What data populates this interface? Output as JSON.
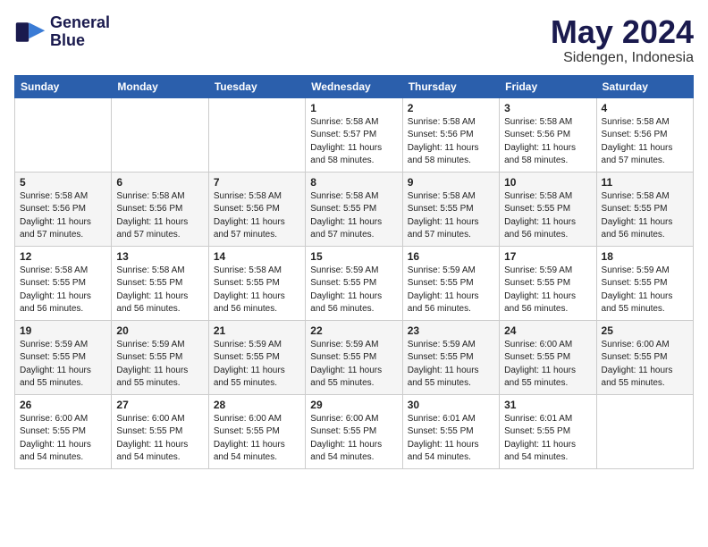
{
  "header": {
    "logo_line1": "General",
    "logo_line2": "Blue",
    "main_title": "May 2024",
    "sub_title": "Sidengen, Indonesia"
  },
  "weekdays": [
    "Sunday",
    "Monday",
    "Tuesday",
    "Wednesday",
    "Thursday",
    "Friday",
    "Saturday"
  ],
  "weeks": [
    [
      {
        "day": "",
        "info": ""
      },
      {
        "day": "",
        "info": ""
      },
      {
        "day": "",
        "info": ""
      },
      {
        "day": "1",
        "info": "Sunrise: 5:58 AM\nSunset: 5:57 PM\nDaylight: 11 hours\nand 58 minutes."
      },
      {
        "day": "2",
        "info": "Sunrise: 5:58 AM\nSunset: 5:56 PM\nDaylight: 11 hours\nand 58 minutes."
      },
      {
        "day": "3",
        "info": "Sunrise: 5:58 AM\nSunset: 5:56 PM\nDaylight: 11 hours\nand 58 minutes."
      },
      {
        "day": "4",
        "info": "Sunrise: 5:58 AM\nSunset: 5:56 PM\nDaylight: 11 hours\nand 57 minutes."
      }
    ],
    [
      {
        "day": "5",
        "info": "Sunrise: 5:58 AM\nSunset: 5:56 PM\nDaylight: 11 hours\nand 57 minutes."
      },
      {
        "day": "6",
        "info": "Sunrise: 5:58 AM\nSunset: 5:56 PM\nDaylight: 11 hours\nand 57 minutes."
      },
      {
        "day": "7",
        "info": "Sunrise: 5:58 AM\nSunset: 5:56 PM\nDaylight: 11 hours\nand 57 minutes."
      },
      {
        "day": "8",
        "info": "Sunrise: 5:58 AM\nSunset: 5:55 PM\nDaylight: 11 hours\nand 57 minutes."
      },
      {
        "day": "9",
        "info": "Sunrise: 5:58 AM\nSunset: 5:55 PM\nDaylight: 11 hours\nand 57 minutes."
      },
      {
        "day": "10",
        "info": "Sunrise: 5:58 AM\nSunset: 5:55 PM\nDaylight: 11 hours\nand 56 minutes."
      },
      {
        "day": "11",
        "info": "Sunrise: 5:58 AM\nSunset: 5:55 PM\nDaylight: 11 hours\nand 56 minutes."
      }
    ],
    [
      {
        "day": "12",
        "info": "Sunrise: 5:58 AM\nSunset: 5:55 PM\nDaylight: 11 hours\nand 56 minutes."
      },
      {
        "day": "13",
        "info": "Sunrise: 5:58 AM\nSunset: 5:55 PM\nDaylight: 11 hours\nand 56 minutes."
      },
      {
        "day": "14",
        "info": "Sunrise: 5:58 AM\nSunset: 5:55 PM\nDaylight: 11 hours\nand 56 minutes."
      },
      {
        "day": "15",
        "info": "Sunrise: 5:59 AM\nSunset: 5:55 PM\nDaylight: 11 hours\nand 56 minutes."
      },
      {
        "day": "16",
        "info": "Sunrise: 5:59 AM\nSunset: 5:55 PM\nDaylight: 11 hours\nand 56 minutes."
      },
      {
        "day": "17",
        "info": "Sunrise: 5:59 AM\nSunset: 5:55 PM\nDaylight: 11 hours\nand 56 minutes."
      },
      {
        "day": "18",
        "info": "Sunrise: 5:59 AM\nSunset: 5:55 PM\nDaylight: 11 hours\nand 55 minutes."
      }
    ],
    [
      {
        "day": "19",
        "info": "Sunrise: 5:59 AM\nSunset: 5:55 PM\nDaylight: 11 hours\nand 55 minutes."
      },
      {
        "day": "20",
        "info": "Sunrise: 5:59 AM\nSunset: 5:55 PM\nDaylight: 11 hours\nand 55 minutes."
      },
      {
        "day": "21",
        "info": "Sunrise: 5:59 AM\nSunset: 5:55 PM\nDaylight: 11 hours\nand 55 minutes."
      },
      {
        "day": "22",
        "info": "Sunrise: 5:59 AM\nSunset: 5:55 PM\nDaylight: 11 hours\nand 55 minutes."
      },
      {
        "day": "23",
        "info": "Sunrise: 5:59 AM\nSunset: 5:55 PM\nDaylight: 11 hours\nand 55 minutes."
      },
      {
        "day": "24",
        "info": "Sunrise: 6:00 AM\nSunset: 5:55 PM\nDaylight: 11 hours\nand 55 minutes."
      },
      {
        "day": "25",
        "info": "Sunrise: 6:00 AM\nSunset: 5:55 PM\nDaylight: 11 hours\nand 55 minutes."
      }
    ],
    [
      {
        "day": "26",
        "info": "Sunrise: 6:00 AM\nSunset: 5:55 PM\nDaylight: 11 hours\nand 54 minutes."
      },
      {
        "day": "27",
        "info": "Sunrise: 6:00 AM\nSunset: 5:55 PM\nDaylight: 11 hours\nand 54 minutes."
      },
      {
        "day": "28",
        "info": "Sunrise: 6:00 AM\nSunset: 5:55 PM\nDaylight: 11 hours\nand 54 minutes."
      },
      {
        "day": "29",
        "info": "Sunrise: 6:00 AM\nSunset: 5:55 PM\nDaylight: 11 hours\nand 54 minutes."
      },
      {
        "day": "30",
        "info": "Sunrise: 6:01 AM\nSunset: 5:55 PM\nDaylight: 11 hours\nand 54 minutes."
      },
      {
        "day": "31",
        "info": "Sunrise: 6:01 AM\nSunset: 5:55 PM\nDaylight: 11 hours\nand 54 minutes."
      },
      {
        "day": "",
        "info": ""
      }
    ]
  ]
}
